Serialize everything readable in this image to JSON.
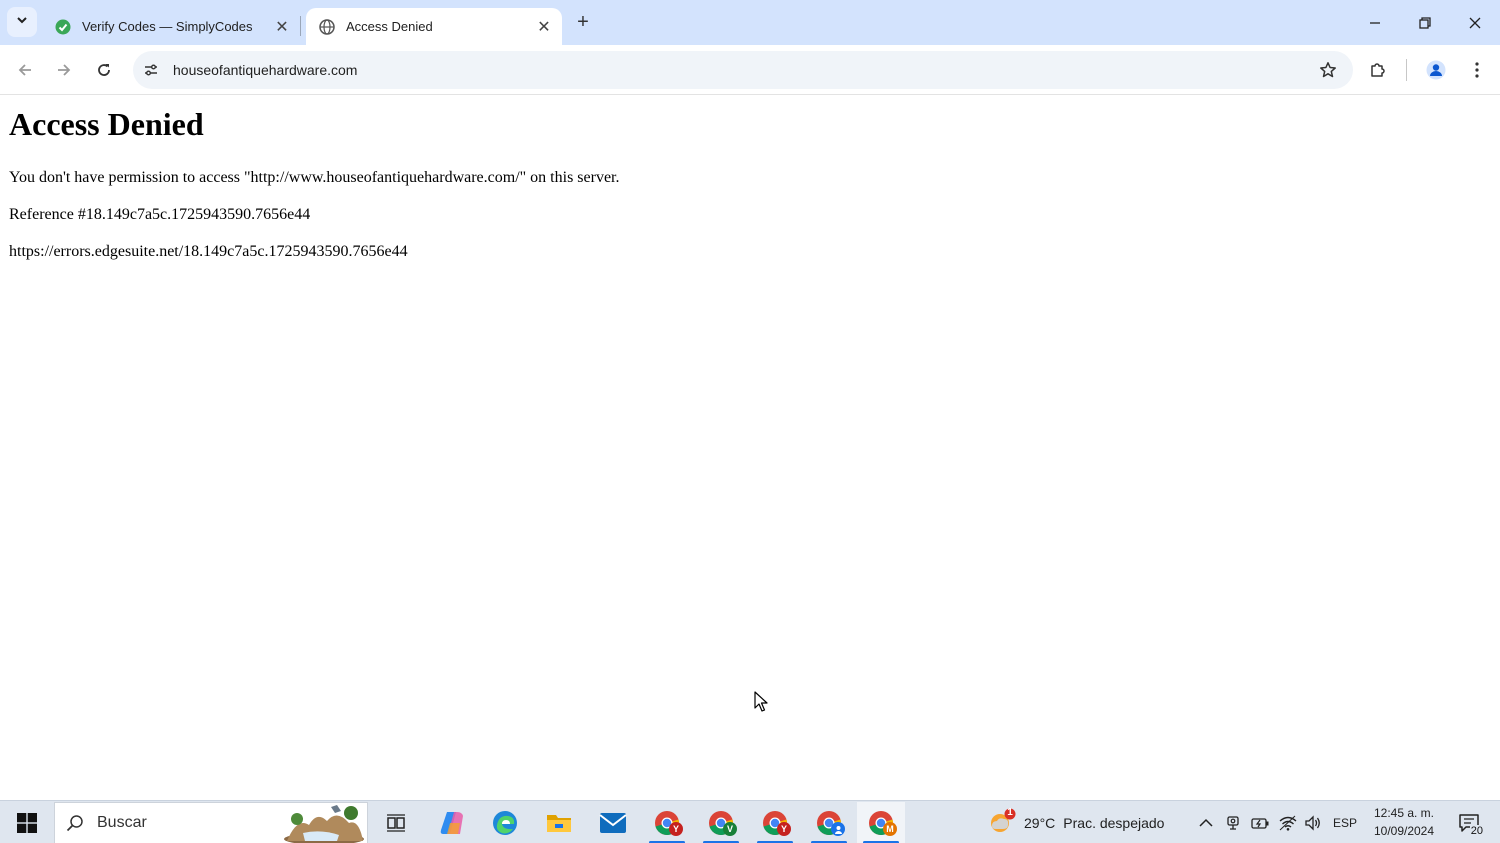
{
  "browser": {
    "tabs": [
      {
        "title": "Verify Codes — SimplyCodes",
        "active": false
      },
      {
        "title": "Access Denied",
        "active": true
      }
    ],
    "url": "houseofantiquehardware.com"
  },
  "page": {
    "heading": "Access Denied",
    "message": "You don't have permission to access \"http://www.houseofantiquehardware.com/\" on this server.",
    "reference": "Reference #18.149c7a5c.1725943590.7656e44",
    "error_url": "https://errors.edgesuite.net/18.149c7a5c.1725943590.7656e44"
  },
  "taskbar": {
    "search_placeholder": "Buscar",
    "chrome_profiles": [
      "Y",
      "V",
      "Y",
      "",
      "M"
    ],
    "weather": {
      "temperature": "29°C",
      "condition": "Prac. despejado",
      "alert_count": "1"
    },
    "language": "ESP",
    "time": "12:45 a. m.",
    "date": "10/09/2024",
    "notification_count": "20"
  },
  "colors": {
    "tabstrip_bg": "#d3e3fd",
    "accent": "#1a73e8",
    "taskbar_bg": "#dfe6ef"
  }
}
